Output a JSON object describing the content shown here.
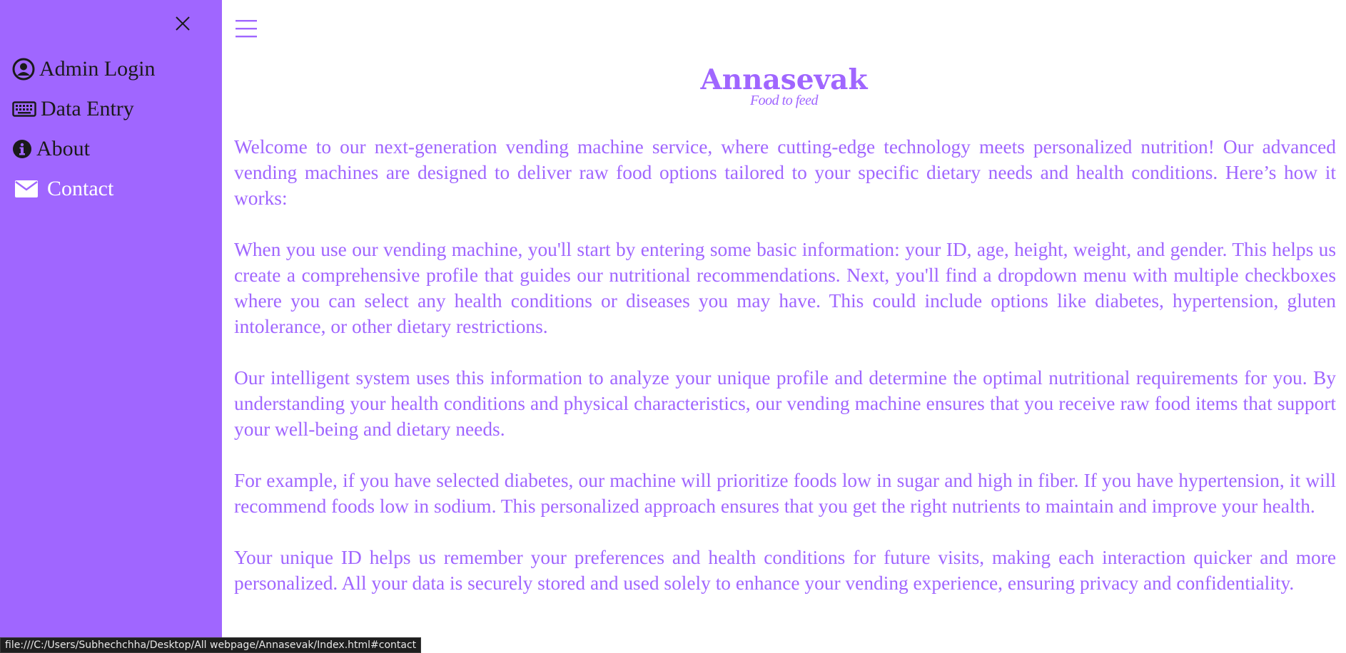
{
  "sidebar": {
    "close_icon": "close-icon",
    "items": [
      {
        "label": "Admin Login",
        "icon": "user-circle-icon"
      },
      {
        "label": "Data Entry",
        "icon": "keyboard-icon"
      },
      {
        "label": "About",
        "icon": "info-circle-icon"
      },
      {
        "label": "Contact",
        "icon": "envelope-icon"
      }
    ]
  },
  "header": {
    "menu_icon": "hamburger-icon",
    "brand": "Annasevak",
    "tagline": "Food to feed"
  },
  "main": {
    "paragraphs": [
      "Welcome to our next-generation vending machine service, where cutting-edge technology meets personalized nutrition! Our advanced vending machines are designed to deliver raw food options tailored to your specific dietary needs and health conditions. Here’s how it works:",
      "When you use our vending machine, you'll start by entering some basic information: your ID, age, height, weight, and gender. This helps us create a comprehensive profile that guides our nutritional recommendations. Next, you'll find a dropdown menu with multiple checkboxes where you can select any health conditions or diseases you may have. This could include options like diabetes, hypertension, gluten intolerance, or other dietary restrictions.",
      "Our intelligent system uses this information to analyze your unique profile and determine the optimal nutritional requirements for you. By understanding your health conditions and physical characteristics, our vending machine ensures that you receive raw food items that support your well-being and dietary needs.",
      "For example, if you have selected diabetes, our machine will prioritize foods low in sugar and high in fiber. If you have hypertension, it will recommend foods low in sodium. This personalized approach ensures that you get the right nutrients to maintain and improve your health.",
      "Your unique ID helps us remember your preferences and health conditions for future visits, making each interaction quicker and more personalized. All your data is securely stored and used solely to enhance your vending experience, ensuring privacy and confidentiality."
    ]
  },
  "status_bar": {
    "url": "file:///C:/Users/Subhechchha/Desktop/All webpage/Annasevak/Index.html#contact"
  },
  "colors": {
    "sidebar_bg": "#a066ff",
    "accent": "#a066ff",
    "nav_text": "#1a1a1a",
    "nav_hover_text": "#ffffff"
  }
}
